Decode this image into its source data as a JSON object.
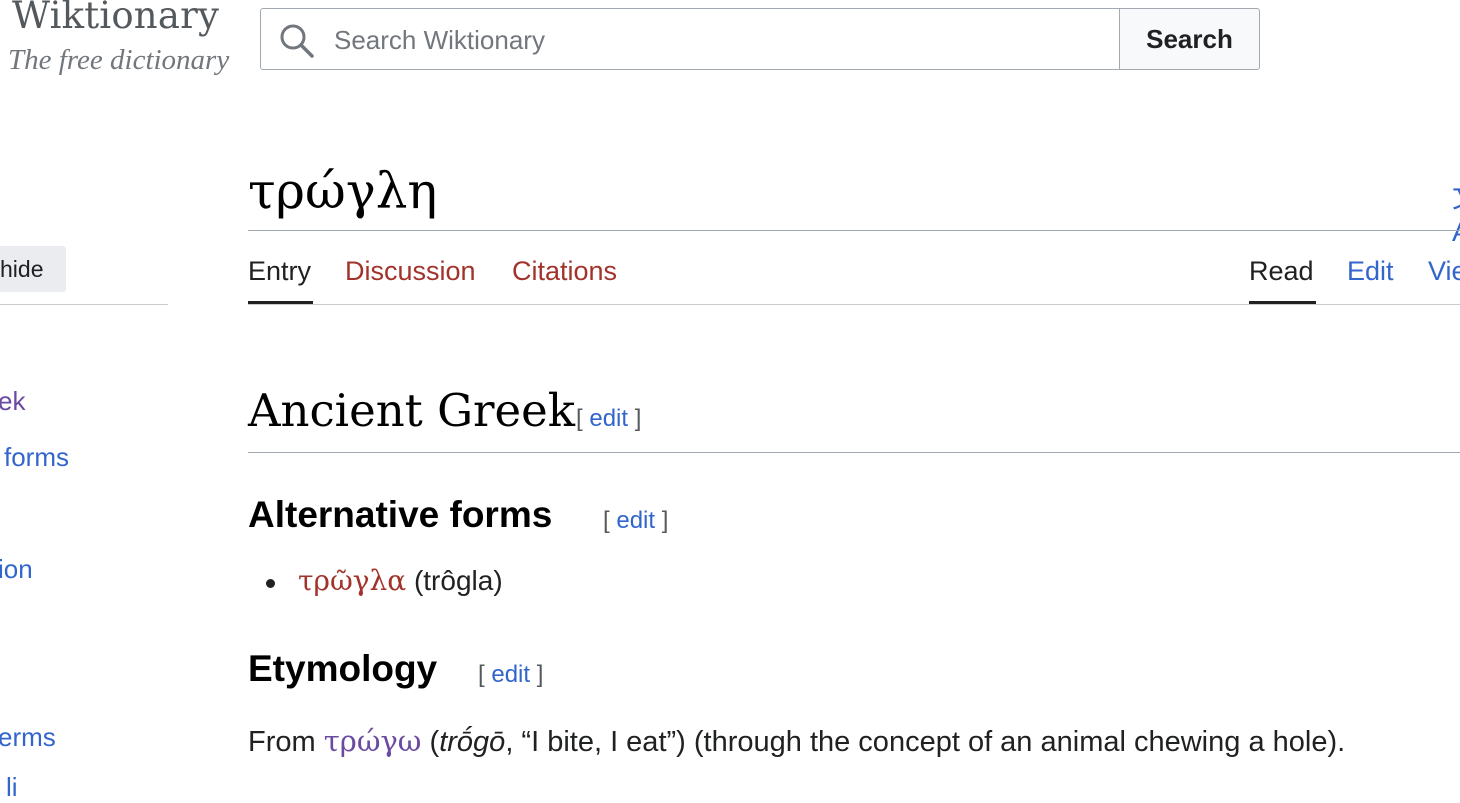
{
  "header": {
    "logo_title": "Wiktionary",
    "logo_tagline": "The free dictionary",
    "search_placeholder": "Search Wiktionary",
    "search_button": "Search"
  },
  "sidebar": {
    "hide_label": "hide",
    "items": [
      {
        "label": "ek"
      },
      {
        "label": "forms"
      },
      {
        "label": "ion"
      },
      {
        "label": "erms"
      },
      {
        "label": "li"
      }
    ]
  },
  "page": {
    "title": "τρώγλη",
    "side_glyph": "文A",
    "tabs_left": [
      "Entry",
      "Discussion",
      "Citations"
    ],
    "tabs_right": [
      "Read",
      "Edit",
      "Vie"
    ]
  },
  "content": {
    "language_heading": "Ancient Greek",
    "edit_open": "[",
    "edit_label": "edit",
    "edit_close": "]",
    "alt_forms_heading": "Alternative forms",
    "alt_form_word": "τρῶγλα",
    "alt_form_translit": "(trôgla)",
    "etymology_heading": "Etymology",
    "etym_from": "From",
    "etym_word": "τρώγω",
    "etym_open": "(",
    "etym_translit": "trṓgō",
    "etym_gloss": ", “I bite, I eat”) (through the concept of an animal chewing a hole)."
  },
  "colors": {
    "link": "#3366cc",
    "redlink": "#a2332b",
    "visited": "#6b4ba1",
    "text": "#202122"
  }
}
